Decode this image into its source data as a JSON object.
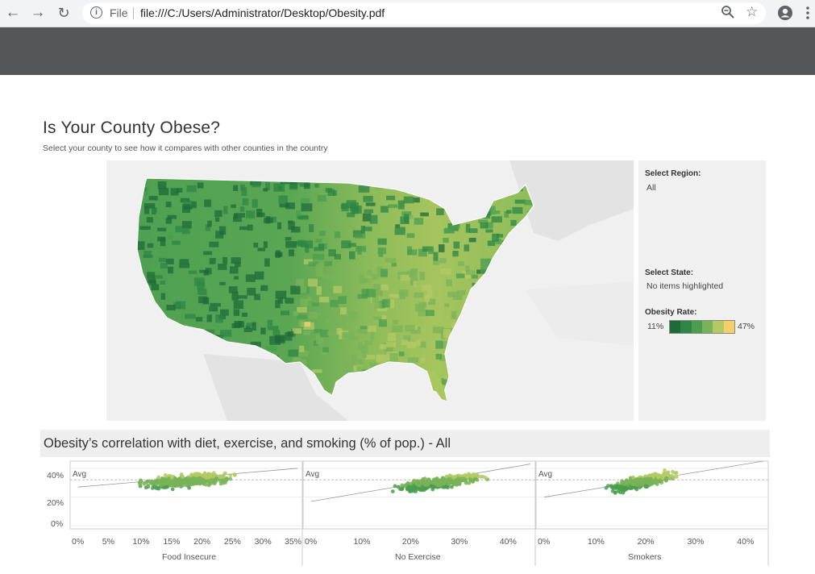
{
  "browser": {
    "back_icon": "arrow-left-icon",
    "forward_icon": "arrow-right-icon",
    "reload_icon": "reload-icon",
    "file_label": "File",
    "url": "file:///C:/Users/Administrator/Desktop/Obesity.pdf",
    "zoom_icon": "zoom-out-icon",
    "bookmark_icon": "star-icon",
    "account_icon": "account-icon",
    "menu_icon": "kebab-menu-icon"
  },
  "dashboard": {
    "title": "Is Your County Obese?",
    "subtitle": "Select your county to see how it compares with other counties in the country",
    "select_region_label": "Select Region:",
    "select_region_value": "All",
    "select_state_label": "Select State:",
    "select_state_value": "No items highlighted",
    "obesity_rate_label": "Obesity Rate:",
    "legend_min": "11%",
    "legend_max": "47%",
    "legend_colors": [
      "#1e6b3a",
      "#2e8645",
      "#4a9e4f",
      "#79b358",
      "#b4c964",
      "#f6cf6b"
    ]
  },
  "scatter": {
    "title": "Obesity’s correlation with diet, exercise, and smoking (% of pop.) - All",
    "avg_label": "Avg",
    "y_ticks": [
      "40%",
      "20%",
      "0%"
    ]
  },
  "chart_data": [
    {
      "type": "scatter",
      "xlabel": "Food Insecure",
      "x_ticks": [
        "0%",
        "5%",
        "10%",
        "15%",
        "20%",
        "25%",
        "30%",
        "35%"
      ],
      "xlim": [
        0,
        36
      ],
      "ylim": [
        -2,
        45
      ],
      "avg_line_y": 32,
      "trend": [
        [
          0,
          27
        ],
        [
          36,
          40
        ]
      ],
      "cloud": {
        "x_center": 18,
        "x_spread": 7,
        "slope": 0.36,
        "intercept": 25,
        "noise": 4.5
      }
    },
    {
      "type": "scatter",
      "xlabel": "No Exercise",
      "x_ticks": [
        "0%",
        "10%",
        "20%",
        "30%",
        "40%"
      ],
      "xlim": [
        0,
        45
      ],
      "ylim": [
        -2,
        45
      ],
      "avg_line_y": 32,
      "trend": [
        [
          0,
          17
        ],
        [
          45,
          43
        ]
      ],
      "cloud": {
        "x_center": 26,
        "x_spread": 8,
        "slope": 0.5,
        "intercept": 17,
        "noise": 4.0
      }
    },
    {
      "type": "scatter",
      "xlabel": "Smokers",
      "x_ticks": [
        "0%",
        "10%",
        "20%",
        "30%",
        "40%"
      ],
      "xlim": [
        0,
        44
      ],
      "ylim": [
        -2,
        45
      ],
      "avg_line_y": 32,
      "trend": [
        [
          0,
          20
        ],
        [
          44,
          45
        ]
      ],
      "cloud": {
        "x_center": 20,
        "x_spread": 6,
        "slope": 0.75,
        "intercept": 16,
        "noise": 4.2
      }
    }
  ]
}
